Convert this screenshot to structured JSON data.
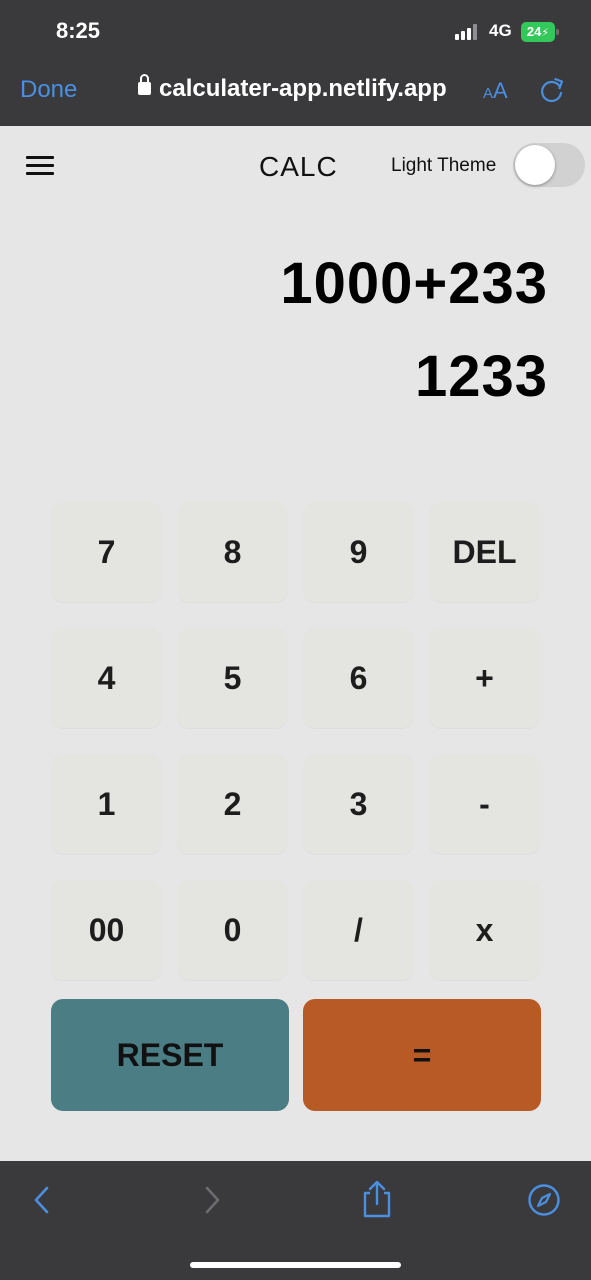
{
  "status": {
    "time": "8:25",
    "network": "4G",
    "battery": "24",
    "signal_icon": "signal-icon",
    "battery_icon": "battery-charging-icon"
  },
  "browser": {
    "done_label": "Done",
    "url": "calculater-app.netlify.app",
    "aa_small": "A",
    "aa_large": "A",
    "accent_color": "#4a8fe0"
  },
  "app": {
    "title": "CALC",
    "theme_label": "Light Theme",
    "theme_toggle_on": false
  },
  "display": {
    "expression": "1000+233",
    "result": "1233"
  },
  "keypad": {
    "rows": [
      [
        "7",
        "8",
        "9",
        "DEL"
      ],
      [
        "4",
        "5",
        "6",
        "+"
      ],
      [
        "1",
        "2",
        "3",
        "-"
      ],
      [
        "00",
        "0",
        "/",
        "x"
      ]
    ],
    "reset_label": "RESET",
    "equals_label": "=",
    "reset_color": "#4b7d85",
    "equals_color": "#b85a26"
  }
}
